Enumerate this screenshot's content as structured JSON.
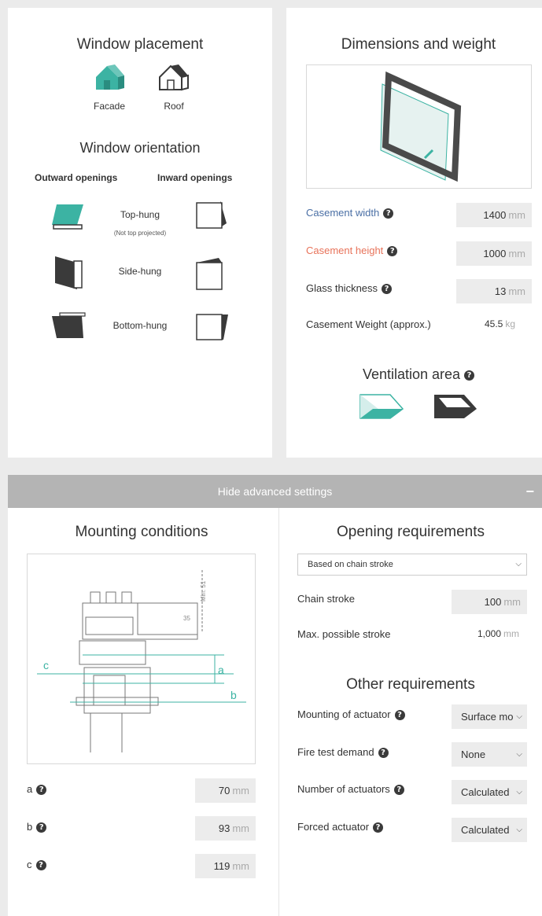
{
  "placement": {
    "title": "Window placement",
    "facade_label": "Facade",
    "roof_label": "Roof"
  },
  "orientation": {
    "title": "Window orientation",
    "outward_header": "Outward openings",
    "inward_header": "Inward openings",
    "top_hung": "Top-hung",
    "top_hung_note": "(Not top projected)",
    "side_hung": "Side-hung",
    "bottom_hung": "Bottom-hung"
  },
  "dimensions": {
    "title": "Dimensions and weight",
    "width_label": "Casement width",
    "width_value": "1400",
    "height_label": "Casement height",
    "height_value": "1000",
    "glass_label": "Glass thickness",
    "glass_value": "13",
    "weight_label": "Casement Weight (approx.)",
    "weight_value": "45.5",
    "unit_mm": "mm",
    "unit_kg": "kg",
    "help_glyph": "?"
  },
  "ventilation": {
    "title": "Ventilation area"
  },
  "advanced": {
    "banner": "Hide advanced settings",
    "collapse_glyph": "−"
  },
  "mounting": {
    "title": "Mounting conditions",
    "diagram_labels": {
      "a": "a",
      "b": "b",
      "c": "c",
      "min": "Min. 51",
      "dim": "35"
    },
    "a_label": "a",
    "a_value": "70",
    "b_label": "b",
    "b_value": "93",
    "c_label": "c",
    "c_value": "119"
  },
  "opening": {
    "title": "Opening requirements",
    "mode_select": "Based on chain stroke",
    "chain_label": "Chain stroke",
    "chain_value": "100",
    "max_label": "Max. possible stroke",
    "max_value": "1,000"
  },
  "other": {
    "title": "Other requirements",
    "mounting_label": "Mounting of actuator",
    "mounting_value": "Surface mo",
    "fire_label": "Fire test demand",
    "fire_value": "None",
    "number_label": "Number of actuators",
    "number_value": "Calculated",
    "forced_label": "Forced actuator",
    "forced_value": "Calculated"
  },
  "colors": {
    "accent": "#3cb3a3",
    "width_label": "#4a6fa5",
    "height_label": "#e8735a",
    "dark": "#3a3a3a"
  }
}
